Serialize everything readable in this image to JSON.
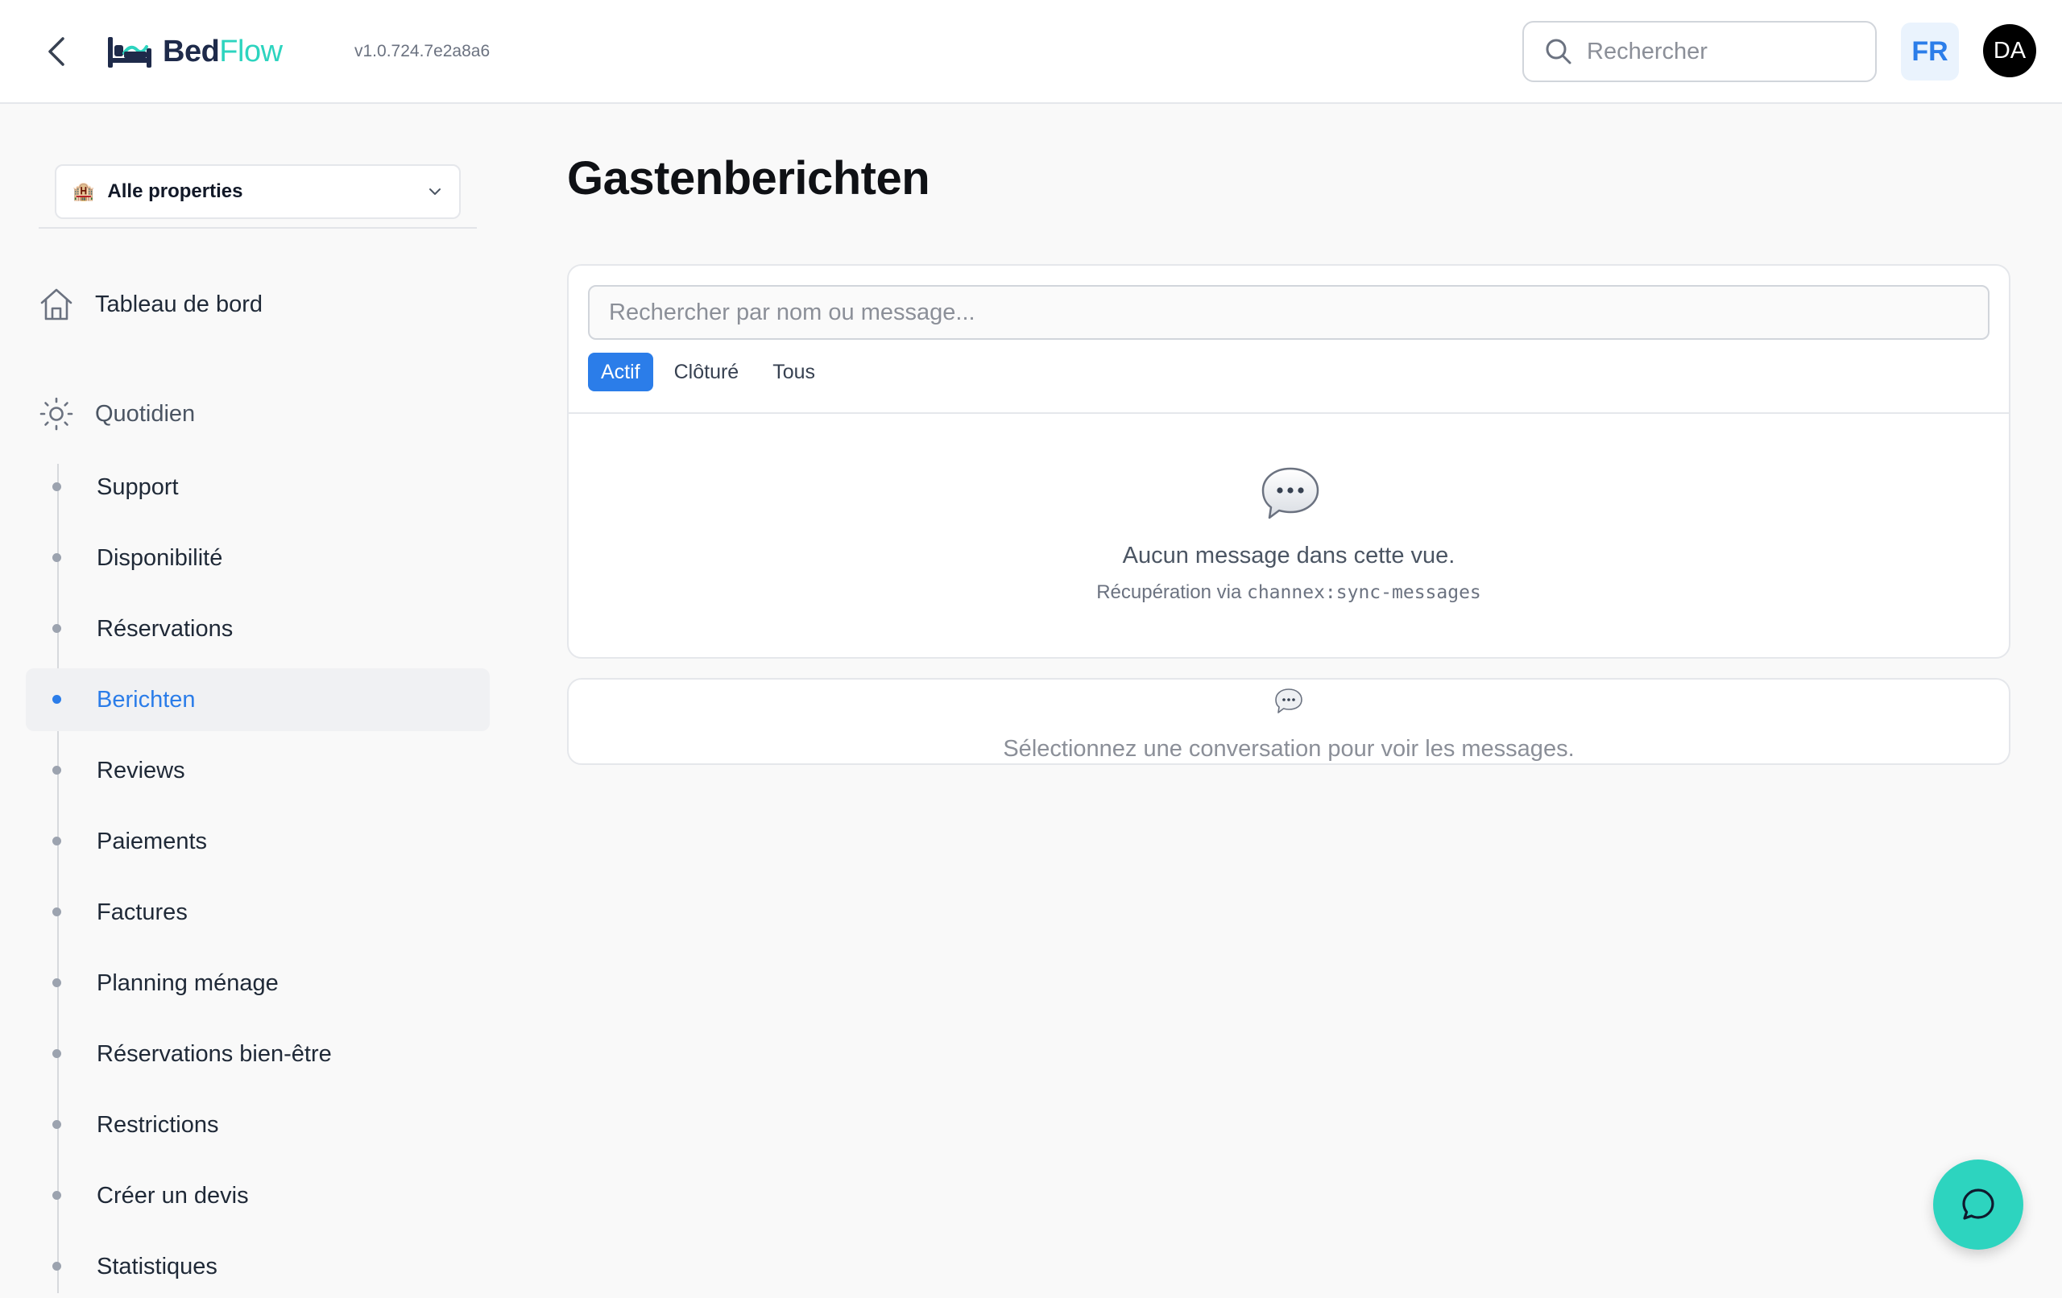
{
  "header": {
    "logo_part1": "Bed",
    "logo_part2": "Flow",
    "version": "v1.0.724.7e2a8a6",
    "search_placeholder": "Rechercher",
    "lang": "FR",
    "avatar": "DA"
  },
  "sidebar": {
    "property_select": "Alle properties",
    "dashboard": "Tableau de bord",
    "section": "Quotidien",
    "items": [
      {
        "label": "Support",
        "active": false
      },
      {
        "label": "Disponibilité",
        "active": false
      },
      {
        "label": "Réservations",
        "active": false
      },
      {
        "label": "Berichten",
        "active": true
      },
      {
        "label": "Reviews",
        "active": false
      },
      {
        "label": "Paiements",
        "active": false
      },
      {
        "label": "Factures",
        "active": false
      },
      {
        "label": "Planning ménage",
        "active": false
      },
      {
        "label": "Réservations bien-être",
        "active": false
      },
      {
        "label": "Restrictions",
        "active": false
      },
      {
        "label": "Créer un devis",
        "active": false
      },
      {
        "label": "Statistiques",
        "active": false
      }
    ]
  },
  "main": {
    "title": "Gastenberichten",
    "search_placeholder": "Rechercher par nom ou message...",
    "tabs": [
      {
        "label": "Actif",
        "active": true
      },
      {
        "label": "Clôturé",
        "active": false
      },
      {
        "label": "Tous",
        "active": false
      }
    ],
    "empty_title": "Aucun message dans cette vue.",
    "empty_sub_prefix": "Récupération via ",
    "empty_sub_code": "channex:sync-messages",
    "select_prompt": "Sélectionnez une conversation pour voir les messages."
  },
  "colors": {
    "accent": "#2b7de9",
    "brand_teal": "#2dd4bf",
    "brand_navy": "#1e2a4a"
  },
  "icons": {
    "back": "chevron-left-icon",
    "logo": "bed-icon",
    "search": "search-icon",
    "property": "hotel-icon",
    "dropdown": "chevron-down-icon",
    "dashboard": "home-icon",
    "section": "sun-icon",
    "empty": "speech-bubble-icon",
    "fab": "chat-icon"
  }
}
